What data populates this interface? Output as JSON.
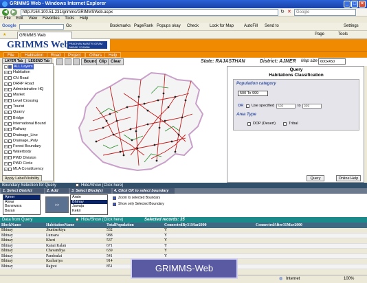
{
  "window": {
    "title": "GRIMMS Web - Windows Internet Explorer"
  },
  "browser": {
    "url": "http://164.100.51.231/grimms/GRIMMSWeb.aspx",
    "search_placeholder": "Google",
    "menu": [
      "File",
      "Edit",
      "View",
      "Favorites",
      "Tools",
      "Help"
    ],
    "google_label": "Google",
    "go_label": "Go",
    "tool_items": [
      "Bookmarks",
      "PageRank",
      "Popups okay",
      "Check",
      "Look for Map",
      "AutoFill",
      "Send to"
    ],
    "settings_label": "Settings",
    "tab_label": "GRIMMS Web",
    "page_label": "Page",
    "tools_label": "Tools"
  },
  "app": {
    "logo": "GRIMMS Web",
    "logo_sub": "PRADHAN MANTRI GRAM SADAK YOJANA",
    "menu": [
      "File",
      "Habitation",
      "Road",
      "Project",
      "Others",
      "Help"
    ],
    "sidebar_tabs": [
      "LAYER Tab",
      "LEGEND Tab"
    ],
    "layers": [
      "ALL Layers",
      "Habitation",
      "CN Road",
      "DRRP Road",
      "Administrative HQ",
      "Market",
      "Level Crossing",
      "Tourist",
      "Quarry",
      "Bridge",
      "International Bound",
      "Railway",
      "Drainage_Line",
      "Drainage_Poly",
      "Forest Boundary",
      "Waterbody",
      "PWD Division",
      "PWD Circle",
      "MLA Constituency"
    ],
    "apply_label": "Apply Label/Visibility",
    "map_buttons": [
      "Bound",
      "Clip",
      "Clear"
    ],
    "state": "State: RAJASTHAN",
    "district": "District: AJMER",
    "map_size_label": "Map size",
    "map_size_value": "600x450"
  },
  "query": {
    "title": "Query",
    "subtitle": "Habitations Classification",
    "population_label": "Population category",
    "population_value": "500 To 999",
    "or_label": "OR",
    "use_specified": "Use specified",
    "to_label": "to",
    "from_value": "500",
    "to_value": "999",
    "area_type_label": "Area Type",
    "ddp": "DDP (Desert)",
    "tribal": "Tribal",
    "query_btn": "Query",
    "help_btn": "Online Help"
  },
  "boundary": {
    "title": "Boundary Selection for Query",
    "hide_show": "Hide/Show (Click here)",
    "col1": "1. Select District",
    "col2": "2. Add Block",
    "col3": "3. Select Block(s)",
    "col4": "4. Click OK to select boundary",
    "districts": [
      "Ajmer",
      "Alwar",
      "Banswara",
      "Baran"
    ],
    "blocks": [
      "Arain",
      "Bhinay",
      "Jawaja",
      "Kekri"
    ],
    "add_btn": ">>",
    "zoom_label": "Zoom to selected Boundary",
    "show_label": "Show only Selected Boundary"
  },
  "data_query": {
    "title": "Data from Query",
    "hide_show": "Hide/Show (Click here)",
    "records": "Selected records: 35",
    "columns": [
      "BlockName",
      "HabitationName",
      "TotalPopulation",
      "ConnectedBy31Mar2000",
      "ConnectedAfter31Mar2000"
    ],
    "rows": [
      [
        "Bhinay",
        "Jhunbarkiya",
        "532",
        "Y",
        ""
      ],
      [
        "Bhinay",
        "Lunsara",
        "988",
        "Y",
        ""
      ],
      [
        "Bhinay",
        "Kheri",
        "537",
        "Y",
        ""
      ],
      [
        "Bhinay",
        "Kanai Kalan",
        "671",
        "Y",
        ""
      ],
      [
        "Bhinay",
        "Chavandiya",
        "639",
        "Y",
        ""
      ],
      [
        "Bhinay",
        "Pandoulai",
        "541",
        "Y",
        ""
      ],
      [
        "Bhinay",
        "Kachariya",
        "914",
        "Y",
        ""
      ],
      [
        "Bhinay",
        "Rajpot",
        "851",
        "Y",
        ""
      ]
    ]
  },
  "status": {
    "internet": "Internet",
    "zoom": "100%"
  },
  "banner": "GRIMMS-Web"
}
